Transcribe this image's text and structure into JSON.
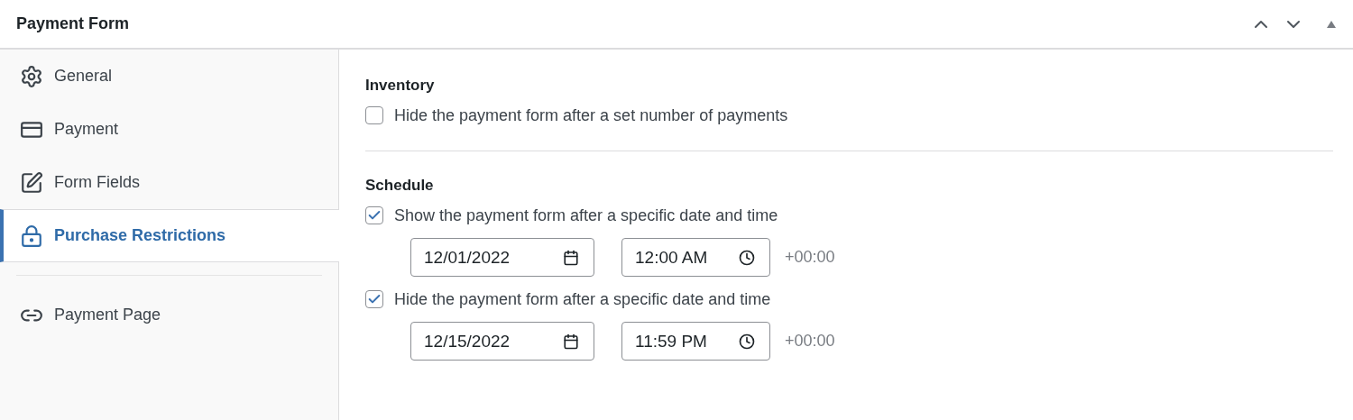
{
  "panel": {
    "title": "Payment Form"
  },
  "sidebar": {
    "groups": [
      [
        {
          "label": "General",
          "kind": "gear",
          "selected": false
        },
        {
          "label": "Payment",
          "kind": "card",
          "selected": false
        },
        {
          "label": "Form Fields",
          "kind": "pencil",
          "selected": false
        },
        {
          "label": "Purchase Restrictions",
          "kind": "lock",
          "selected": true
        }
      ],
      [
        {
          "label": "Payment Page",
          "kind": "link",
          "selected": false
        }
      ]
    ]
  },
  "sections": [
    {
      "heading": "Inventory",
      "options": [
        {
          "label": "Hide the payment form after a set number of payments",
          "checked": false
        }
      ]
    },
    {
      "heading": "Schedule",
      "options": [
        {
          "label": "Show the payment form after a specific date and time",
          "checked": true,
          "date": "12/01/2022",
          "time": "12:00 AM",
          "offset": "+00:00"
        },
        {
          "label": "Hide the payment form after a specific date and time",
          "checked": true,
          "date": "12/15/2022",
          "time": "11:59 PM",
          "offset": "+00:00"
        }
      ]
    }
  ]
}
